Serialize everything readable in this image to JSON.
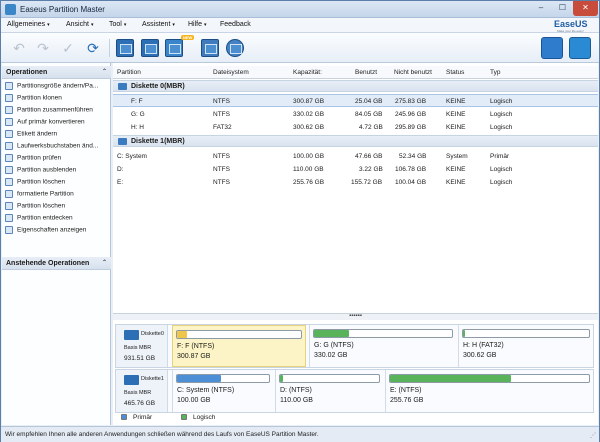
{
  "window": {
    "title": "Easeus Partition Master"
  },
  "menu": [
    {
      "label": "Allgemeines",
      "chev": "▾"
    },
    {
      "label": "Ansicht",
      "chev": "▾"
    },
    {
      "label": "Tool",
      "chev": "▾"
    },
    {
      "label": "Assistent",
      "chev": "▾"
    },
    {
      "label": "Hilfe",
      "chev": "▾"
    },
    {
      "label": "Feedback",
      "chev": ""
    }
  ],
  "brand": {
    "name": "EaseUS",
    "tagline": "Make your life easy!"
  },
  "toolbar": {
    "new_badge": "NEW"
  },
  "sidebar": {
    "operations_title": "Operationen",
    "pending_title": "Anstehende Operationen",
    "items": [
      {
        "label": "Partitionsgröße ändern/Pa..."
      },
      {
        "label": "Partition klonen"
      },
      {
        "label": "Partition zusammenführen"
      },
      {
        "label": "Auf primär konvertieren"
      },
      {
        "label": "Etikett ändern"
      },
      {
        "label": "Laufwerksbuchstaben änd..."
      },
      {
        "label": "Partition prüfen"
      },
      {
        "label": "Partition ausblenden"
      },
      {
        "label": "Partition löschen"
      },
      {
        "label": "formatierte Partition"
      },
      {
        "label": "Partition löschen"
      },
      {
        "label": "Partition entdecken"
      },
      {
        "label": "Eigenschaften anzeigen"
      }
    ]
  },
  "table": {
    "columns": [
      "Partition",
      "Dateisystem",
      "Kapazität:",
      "Benutzt",
      "Nicht benutzt",
      "Status",
      "Typ"
    ],
    "disks": [
      {
        "title": "Diskette 0(MBR)",
        "rows": [
          {
            "partition": "F: F",
            "fs": "NTFS",
            "capacity": "300.87 GB",
            "used": "25.04 GB",
            "unused": "275.83 GB",
            "status": "KEINE",
            "type": "Logisch"
          },
          {
            "partition": "G: G",
            "fs": "NTFS",
            "capacity": "330.02 GB",
            "used": "84.05 GB",
            "unused": "245.96 GB",
            "status": "KEINE",
            "type": "Logisch"
          },
          {
            "partition": "H: H",
            "fs": "FAT32",
            "capacity": "300.62 GB",
            "used": "4.72 GB",
            "unused": "295.89 GB",
            "status": "KEINE",
            "type": "Logisch"
          }
        ]
      },
      {
        "title": "Diskette 1(MBR)",
        "rows": [
          {
            "partition": "C: System",
            "fs": "NTFS",
            "capacity": "100.00 GB",
            "used": "47.66 GB",
            "unused": "52.34 GB",
            "status": "System",
            "type": "Primär"
          },
          {
            "partition": "D:",
            "fs": "NTFS",
            "capacity": "110.00 GB",
            "used": "3.22 GB",
            "unused": "106.78 GB",
            "status": "KEINE",
            "type": "Logisch"
          },
          {
            "partition": "E:",
            "fs": "NTFS",
            "capacity": "255.76 GB",
            "used": "155.72 GB",
            "unused": "100.04 GB",
            "status": "KEINE",
            "type": "Logisch"
          }
        ]
      }
    ]
  },
  "splitter": "▪▪▪▪▪▪",
  "diskmap": [
    {
      "name": "Diskette0",
      "type": "Basis MBR",
      "size": "931.51 GB",
      "partitions": [
        {
          "label": "F: F (NTFS)",
          "size": "300.87 GB",
          "used_fraction": 0.083,
          "color": "#f0c64a"
        },
        {
          "label": "G: G (NTFS)",
          "size": "330.02 GB",
          "used_fraction": 0.255,
          "color": "#58b35a"
        },
        {
          "label": "H: H (FAT32)",
          "size": "300.62 GB",
          "used_fraction": 0.016,
          "color": "#58b35a"
        }
      ]
    },
    {
      "name": "Diskette1",
      "type": "Basis MBR",
      "size": "465.76 GB",
      "partitions": [
        {
          "label": "C: System (NTFS)",
          "size": "100.00 GB",
          "used_fraction": 0.477,
          "color": "#4d8fd6"
        },
        {
          "label": "D: (NTFS)",
          "size": "110.00 GB",
          "used_fraction": 0.029,
          "color": "#58b35a"
        },
        {
          "label": "E: (NTFS)",
          "size": "255.76 GB",
          "used_fraction": 0.609,
          "color": "#58b35a"
        }
      ]
    }
  ],
  "legend": {
    "primary": "Primär",
    "logical": "Logisch",
    "primary_color": "#4d8fd6",
    "logical_color": "#58b35a"
  },
  "status": "Wir empfehlen Ihnen alle anderen Anwendungen schließen während des Laufs von EaseUS Partition Master."
}
